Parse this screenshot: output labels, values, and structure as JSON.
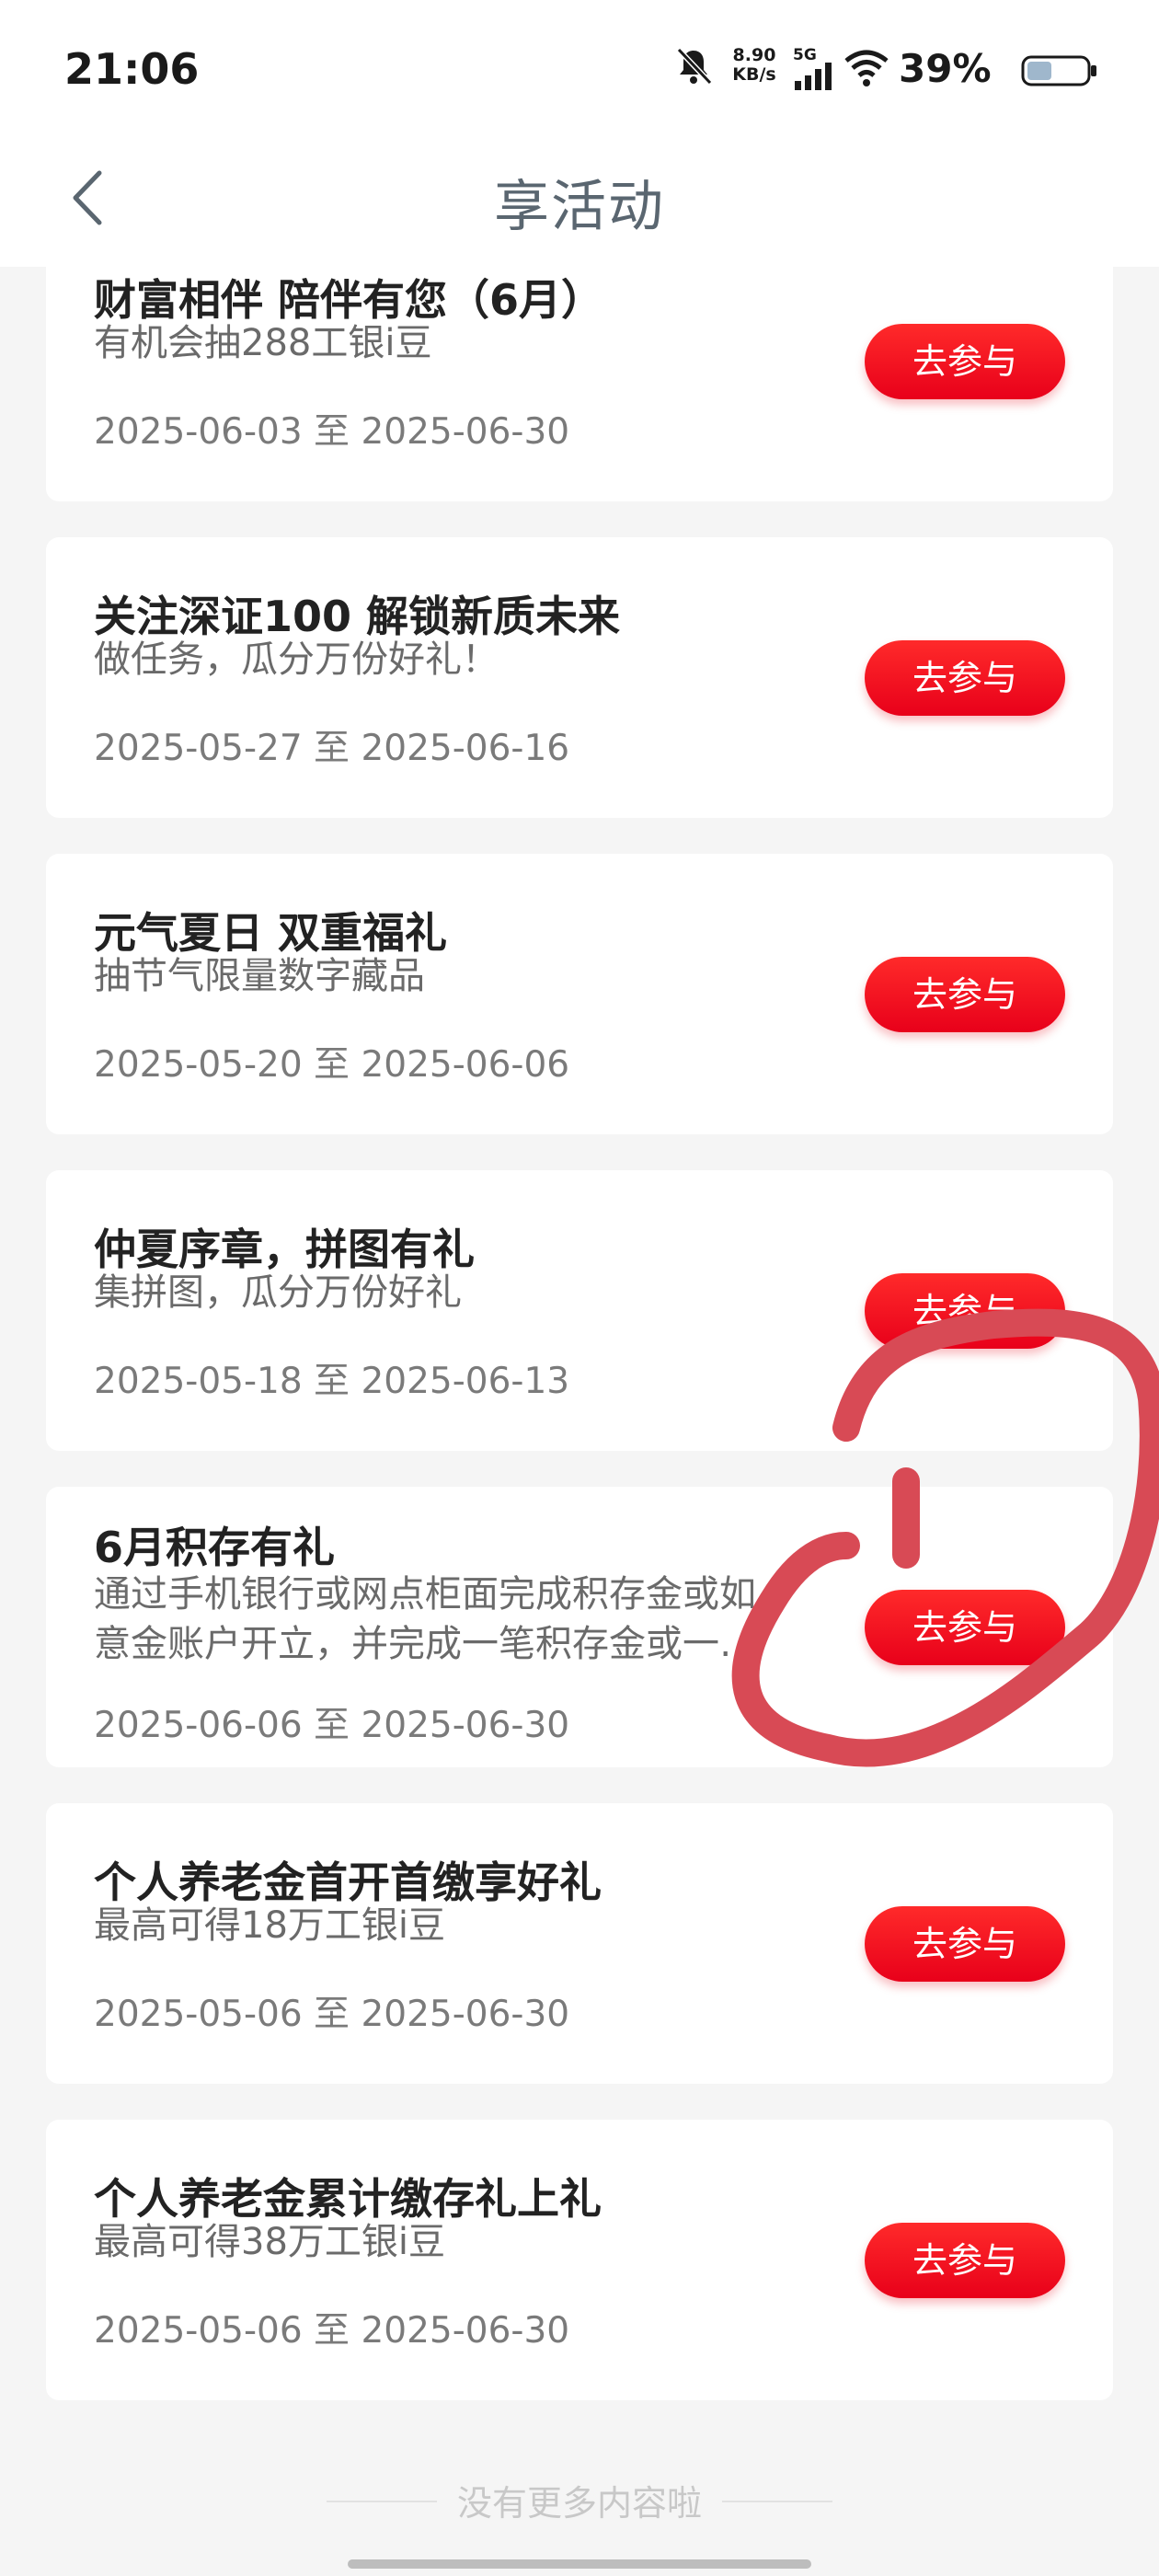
{
  "status_bar": {
    "time": "21:06",
    "net_speed_value": "8.90",
    "net_speed_unit": "KB/s",
    "network": "5G",
    "battery": "39%",
    "icons": [
      "bell-muted-icon",
      "signal-icon",
      "wifi-icon",
      "battery-icon"
    ]
  },
  "nav": {
    "title": "享活动",
    "back_icon": "chevron-left-icon"
  },
  "activities": [
    {
      "title": "财富相伴 陪伴有您（6月）",
      "desc": "有机会抽288工银i豆",
      "date": "2025-06-03 至 2025-06-30",
      "button": "去参与"
    },
    {
      "title": "关注深证100 解锁新质未来",
      "desc": "做任务，瓜分万份好礼！",
      "date": "2025-05-27 至 2025-06-16",
      "button": "去参与"
    },
    {
      "title": "元气夏日 双重福礼",
      "desc": "抽节气限量数字藏品",
      "date": "2025-05-20 至 2025-06-06",
      "button": "去参与"
    },
    {
      "title": "仲夏序章，拼图有礼",
      "desc": "集拼图，瓜分万份好礼",
      "date": "2025-05-18 至 2025-06-13",
      "button": "去参与"
    },
    {
      "title": "6月积存有礼",
      "desc": "通过手机银行或网点柜面完成积存金或如\n意金账户开立，并完成一笔积存金或一…",
      "date": "2025-06-06 至 2025-06-30",
      "button": "去参与"
    },
    {
      "title": "个人养老金首开首缴享好礼",
      "desc": "最高可得18万工银i豆",
      "date": "2025-05-06 至 2025-06-30",
      "button": "去参与"
    },
    {
      "title": "个人养老金累计缴存礼上礼",
      "desc": "最高可得38万工银i豆",
      "date": "2025-05-06 至 2025-06-30",
      "button": "去参与"
    }
  ],
  "footer": {
    "text": "没有更多内容啦"
  },
  "colors": {
    "accent_red": "#e8001a",
    "annotation_red": "#d84a55",
    "background": "#f5f5f5"
  }
}
